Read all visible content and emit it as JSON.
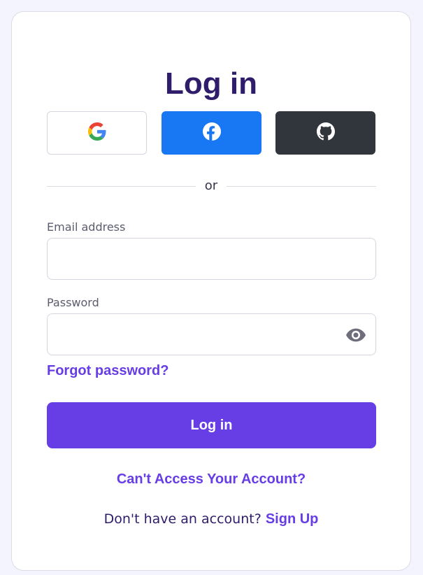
{
  "title": "Log in",
  "social": {
    "google_icon": "google-icon",
    "facebook_icon": "facebook-icon",
    "github_icon": "github-icon"
  },
  "divider": {
    "text": "or"
  },
  "email": {
    "label": "Email address",
    "value": "",
    "placeholder": ""
  },
  "password": {
    "label": "Password",
    "value": "",
    "placeholder": "",
    "toggle_icon": "eye-icon"
  },
  "links": {
    "forgot_password": "Forgot password?",
    "cant_access": "Can't Access Your Account?",
    "signup_prompt": "Don't have an account?",
    "signup": "Sign Up"
  },
  "login_button": "Log in",
  "colors": {
    "accent": "#673de6",
    "title": "#2f1c6a",
    "facebook": "#1877f2",
    "github": "#31363d",
    "background": "#f4f4ff"
  }
}
